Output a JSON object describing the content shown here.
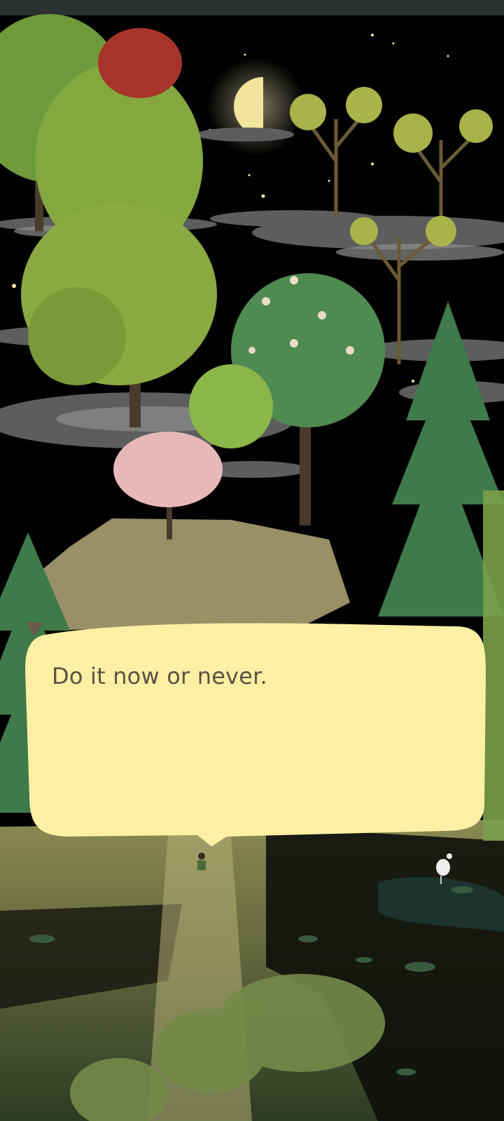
{
  "dialog": {
    "text": "Do it now or never.",
    "advance_icon": "triangle-down-icon"
  },
  "colors": {
    "sky": "#000000",
    "moon": "#f1e59e",
    "dialog_fill": "#fdf0a4",
    "dialog_text": "#5a5244",
    "advance": "#6b5a4a"
  }
}
